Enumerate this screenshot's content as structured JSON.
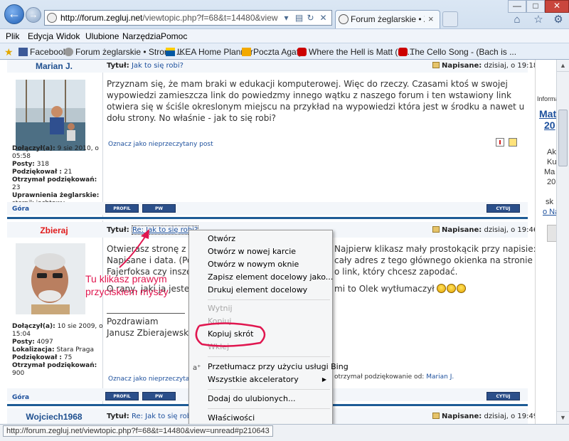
{
  "browser": {
    "url_host": "http://forum.zegluj.net",
    "url_path": "/viewtopic.php?f=68&t=14480&view=unread#unre",
    "tab_title": "Forum żeglarskie • Zobacz ...",
    "tab_close": "×",
    "menu": [
      "Plik",
      "Edycja",
      "Widok",
      "Ulubione",
      "Narzędzia",
      "Pomoc"
    ],
    "favorites": [
      {
        "label": "Facebook",
        "icon": "facebook-icon",
        "color": "#3b5998"
      },
      {
        "label": "Forum żeglarskie • Strona ...",
        "icon": "forum-icon",
        "color": "#777777"
      },
      {
        "label": "IKEA Home Planner",
        "icon": "ikea-icon",
        "color": "#0058a3"
      },
      {
        "label": "Poczta Agaty",
        "icon": "mail-icon",
        "color": "#f2a900"
      },
      {
        "label": "Where the Hell is Matt (20...",
        "icon": "youtube-icon",
        "color": "#cc0000"
      },
      {
        "label": "The Cello Song - (Bach is ...",
        "icon": "youtube-icon",
        "color": "#cc0000"
      }
    ]
  },
  "posts": [
    {
      "author": "Marian J.",
      "title_label": "Tytuł:",
      "title": "Jak to się robi?",
      "posted_label": "Napisane:",
      "posted_time": "dzisiaj, o 19:18",
      "body": "Przyznam się, że mam braki w edukacji komputerowej. Więc do rzeczy. Czasami ktoś w swojej wypowiedzi zamieszcza link do powiedzmy innego wątku z naszego forum i ten wstawiony link otwiera się w ściśle okreslonym miejscu na przykład na wypowiedzi która jest w środku a nawet u dołu strony. No właśnie - jak to się robi?",
      "stats": [
        {
          "k": "Dołączył(a):",
          "v": "9 sie 2010, o 05:58"
        },
        {
          "k": "Posty:",
          "v": "318"
        },
        {
          "k": "Podziękował :",
          "v": "21"
        },
        {
          "k": "Otrzymał podziękowań:",
          "v": "23"
        },
        {
          "k": "Uprawnienia żeglarskie:",
          "v": "sternik jachtowy"
        }
      ],
      "unread_link": "Oznacz jako nieprzeczytany post",
      "top_link": "Góra",
      "buttons": [
        "PROFIL",
        "PW",
        "CYTUJ"
      ]
    },
    {
      "author": "Zbieraj",
      "title_label": "Tytuł:",
      "title": "Re: Jak to się robi?",
      "posted_label": "Napisane:",
      "posted_time": "dzisiaj, o 19:46",
      "body_left": [
        "Otwierasz stronę z tym",
        "Napisane i data. (Po p",
        "Fajerfoksa czy inszej G",
        "O rany, jaki ja jestem m"
      ],
      "body_right": [
        "Najpierw klikasz mały prostokącik przy napisie:",
        "cały adres z tego głównego okienka na stronie",
        "o link, który chcesz zapodać.",
        "mi to Olek wytłumaczył"
      ],
      "signature": [
        "Pozdrawiam",
        "Janusz Zbierajewski"
      ],
      "stats": [
        {
          "k": "Dołączył(a):",
          "v": "10 sie 2009, o 15:04"
        },
        {
          "k": "Posty:",
          "v": "4097"
        },
        {
          "k": "Lokalizacja:",
          "v": "Stara Praga"
        },
        {
          "k": "Podziękował :",
          "v": "75"
        },
        {
          "k": "Otrzymał podziękowań:",
          "v": "900"
        }
      ],
      "unread_link": "Oznacz jako nieprzeczyta",
      "thanks_text": "otrzymał podziękowanie od:",
      "thanks_from": "Marian J.",
      "top_link": "Góra",
      "buttons": [
        "PROFIL",
        "PW",
        "CYTUJ"
      ]
    },
    {
      "author": "Wojciech1968",
      "title_label": "Tytuł:",
      "title": "Re: Jak to się robi?",
      "posted_label": "Napisane:",
      "posted_time": "dzisiaj, o 19:49"
    }
  ],
  "right_panel": {
    "info": "Informa",
    "link1": [
      "Matt",
      "20"
    ],
    "lines": [
      "Ak",
      "Ku",
      "Ma",
      "20"
    ],
    "sk": "sk",
    "link2": "o Na"
  },
  "annotation": {
    "text": "Tu klikasz prawym przyciskiem myszy",
    "color": "#e0164f"
  },
  "context_menu": {
    "items": [
      {
        "label": "Otwórz",
        "enabled": true
      },
      {
        "label": "Otwórz w nowej karcie",
        "enabled": true
      },
      {
        "label": "Otwórz w nowym oknie",
        "enabled": true
      },
      {
        "label": "Zapisz element docelowy jako...",
        "enabled": true
      },
      {
        "label": "Drukuj element docelowy",
        "enabled": true
      },
      {
        "label": "Wytnij",
        "enabled": false
      },
      {
        "label": "Kopiuj",
        "enabled": false
      },
      {
        "label": "Kopiuj skrót",
        "enabled": true,
        "highlighted_by_annotation": true
      },
      {
        "label": "Wklej",
        "enabled": false
      },
      {
        "label": "Przetłumacz przy użyciu usługi Bing",
        "enabled": true,
        "icon": "translate-icon"
      },
      {
        "label": "Wszystkie akceleratory",
        "enabled": true,
        "submenu": true
      },
      {
        "label": "Dodaj do ulubionych...",
        "enabled": true
      },
      {
        "label": "Właściwości",
        "enabled": true
      }
    ]
  },
  "status_bar": {
    "text": "http://forum.zegluj.net/viewtopic.php?f=68&t=14480&view=unread#p210643"
  },
  "colors": {
    "accent_blue": "#1e5c96",
    "author_red": "#e01b1b",
    "link_blue": "#1c4f9c",
    "annotation_pink": "#e0164f"
  }
}
